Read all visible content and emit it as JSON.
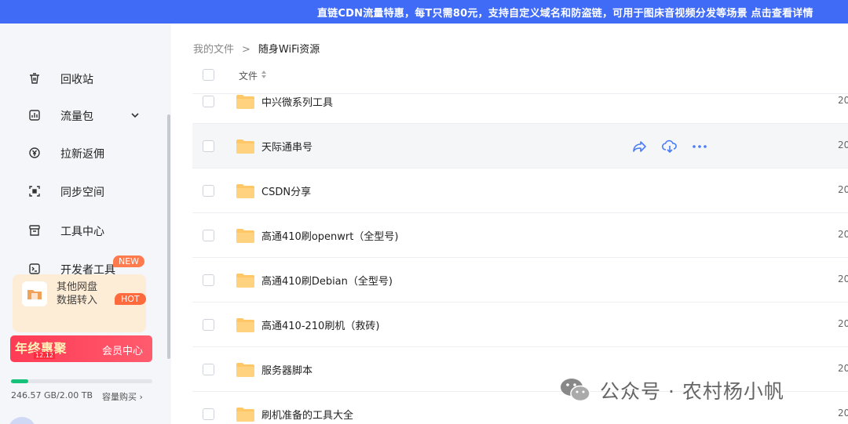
{
  "banner": {
    "text": "直链CDN流量特惠，每T只需80元，支持自定义域名和防盗链，可用于图床音视频分发等场景 点击查看详情"
  },
  "sidebar": {
    "items": [
      {
        "label": "回收站",
        "icon": "trash-icon"
      },
      {
        "label": "流量包",
        "icon": "traffic-package-icon"
      },
      {
        "label": "拉新返佣",
        "icon": "yuan-coin-icon"
      },
      {
        "label": "同步空间",
        "icon": "sync-space-icon"
      },
      {
        "label": "工具中心",
        "icon": "toolbox-icon"
      },
      {
        "label": "开发者工具",
        "icon": "terminal-icon"
      }
    ],
    "new_badge": "NEW",
    "hot_badge": "HOT",
    "import_card": {
      "line1": "其他网盘",
      "line2": "数据转入"
    },
    "vip": {
      "promo": "年终惠聚",
      "date": "12.12",
      "label": "会员中心"
    },
    "storage": {
      "used_text": "246.57 GB/2.00 TB",
      "used_fraction": 0.12,
      "buy_label": "容量购买"
    }
  },
  "breadcrumb": {
    "root": "我的文件",
    "separator": ">",
    "current": "随身WiFi资源"
  },
  "table": {
    "column_file": "文件",
    "rows": [
      {
        "name": "中兴微系列工具",
        "date": "20"
      },
      {
        "name": "天际通串号",
        "date": "20",
        "hover": true
      },
      {
        "name": "CSDN分享",
        "date": "20"
      },
      {
        "name": "高通410刷openwrt（全型号)",
        "date": "20"
      },
      {
        "name": "高通410刷Debian（全型号)",
        "date": "20"
      },
      {
        "name": "高通410-210刷机（救砖)",
        "date": "20"
      },
      {
        "name": "服务器脚本",
        "date": "20"
      },
      {
        "name": "刷机准备的工具大全",
        "date": "20"
      }
    ]
  },
  "watermark": {
    "text": "公众号 · 农村杨小帆"
  },
  "colors": {
    "banner": "#3f6bf7",
    "folder": "#ffc766",
    "accent": "#4a7cf7",
    "storage": "#18c27a"
  }
}
